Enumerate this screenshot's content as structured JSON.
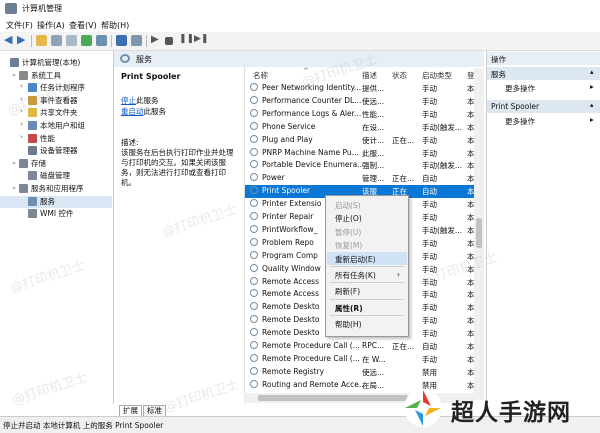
{
  "window": {
    "title": "计算机管理"
  },
  "menu": [
    "文件(F)",
    "操作(A)",
    "查看(V)",
    "帮助(H)"
  ],
  "header": {
    "label": "服务"
  },
  "tree": [
    {
      "label": "计算机管理(本地)",
      "level": 0,
      "arrow": "",
      "icon": "computer-icon",
      "color": "#6b7f94"
    },
    {
      "label": "系统工具",
      "level": 1,
      "arrow": "⌄",
      "icon": "tools-icon",
      "color": "#8a8a8a"
    },
    {
      "label": "任务计划程序",
      "level": 2,
      "arrow": "›",
      "icon": "clock-icon",
      "color": "#4b86c9"
    },
    {
      "label": "事件查看器",
      "level": 2,
      "arrow": "›",
      "icon": "event-icon",
      "color": "#c99b3b"
    },
    {
      "label": "共享文件夹",
      "level": 2,
      "arrow": "›",
      "icon": "folder-icon",
      "color": "#e2b742"
    },
    {
      "label": "本地用户和组",
      "level": 2,
      "arrow": "›",
      "icon": "users-icon",
      "color": "#6a8bb5"
    },
    {
      "label": "性能",
      "level": 2,
      "arrow": "›",
      "icon": "perf-icon",
      "color": "#c24a4a"
    },
    {
      "label": "设备管理器",
      "level": 2,
      "arrow": "",
      "icon": "device-icon",
      "color": "#6d7c8c"
    },
    {
      "label": "存储",
      "level": 1,
      "arrow": "⌄",
      "icon": "storage-icon",
      "color": "#7b8796"
    },
    {
      "label": "磁盘管理",
      "level": 2,
      "arrow": "",
      "icon": "disk-icon",
      "color": "#7b8796"
    },
    {
      "label": "服务和应用程序",
      "level": 1,
      "arrow": "⌄",
      "icon": "apps-icon",
      "color": "#7b8796"
    },
    {
      "label": "服务",
      "level": 2,
      "arrow": "",
      "icon": "services-icon",
      "color": "#6d8fb0",
      "selected": true
    },
    {
      "label": "WMI 控件",
      "level": 2,
      "arrow": "",
      "icon": "wmi-icon",
      "color": "#7b8796"
    }
  ],
  "desc": {
    "name": "Print Spooler",
    "stop": "停止",
    "stop_suffix": "此服务",
    "restart": "重启动",
    "restart_suffix": "此服务",
    "label": "描述:",
    "text": "该服务在后台执行打印作业并处理与打印机的交互。如果关闭该服务，则无法进行打印或查看打印机。"
  },
  "columns": [
    "名称",
    "描述",
    "状态",
    "启动类型",
    "登"
  ],
  "services": [
    {
      "name": "Peer Networking Identity...",
      "desc": "提供...",
      "status": "",
      "start": "手动",
      "logon": "本"
    },
    {
      "name": "Performance Counter DL...",
      "desc": "使远...",
      "status": "",
      "start": "手动",
      "logon": "本"
    },
    {
      "name": "Performance Logs & Aler...",
      "desc": "性能...",
      "status": "",
      "start": "手动",
      "logon": "本"
    },
    {
      "name": "Phone Service",
      "desc": "在设...",
      "status": "",
      "start": "手动(触发...",
      "logon": "本"
    },
    {
      "name": "Plug and Play",
      "desc": "使计...",
      "status": "正在...",
      "start": "手动",
      "logon": "本"
    },
    {
      "name": "PNRP Machine Name Pu...",
      "desc": "此服...",
      "status": "",
      "start": "手动",
      "logon": "本"
    },
    {
      "name": "Portable Device Enumera...",
      "desc": "强制...",
      "status": "",
      "start": "手动(触发...",
      "logon": "本"
    },
    {
      "name": "Power",
      "desc": "管理...",
      "status": "正在...",
      "start": "自动",
      "logon": "本"
    },
    {
      "name": "Print Spooler",
      "desc": "该服",
      "status": "正在",
      "start": "自动",
      "logon": "本",
      "selected": true
    },
    {
      "name": "Printer Extensio",
      "desc": "",
      "status": "",
      "start": "手动",
      "logon": "本"
    },
    {
      "name": "Printer Repair",
      "desc": "",
      "status": "",
      "start": "手动",
      "logon": "本"
    },
    {
      "name": "PrintWorkflow_",
      "desc": "",
      "status": "",
      "start": "手动(触发...",
      "logon": "本"
    },
    {
      "name": "Problem Repo",
      "desc": "",
      "status": "",
      "start": "手动",
      "logon": "本"
    },
    {
      "name": "Program Comp",
      "desc": "",
      "status": "",
      "start": "手动",
      "logon": "本"
    },
    {
      "name": "Quality Window",
      "desc": "",
      "status": "",
      "start": "手动",
      "logon": "本"
    },
    {
      "name": "Remote Access",
      "desc": "",
      "status": "",
      "start": "手动",
      "logon": "本"
    },
    {
      "name": "Remote Access",
      "desc": "",
      "status": "",
      "start": "手动",
      "logon": "本"
    },
    {
      "name": "Remote Deskto",
      "desc": "",
      "status": "",
      "start": "手动",
      "logon": "本"
    },
    {
      "name": "Remote Deskto",
      "desc": "",
      "status": "",
      "start": "手动",
      "logon": "本"
    },
    {
      "name": "Remote Deskto",
      "desc": "",
      "status": "",
      "start": "手动",
      "logon": "本"
    },
    {
      "name": "Remote Procedure Call (...",
      "desc": "RPC...",
      "status": "正在...",
      "start": "自动",
      "logon": "本"
    },
    {
      "name": "Remote Procedure Call (...",
      "desc": "在 W...",
      "status": "",
      "start": "手动",
      "logon": "本"
    },
    {
      "name": "Remote Registry",
      "desc": "使远...",
      "status": "",
      "start": "禁用",
      "logon": "本"
    },
    {
      "name": "Routing and Remote Acce...",
      "desc": "在局...",
      "status": "",
      "start": "禁用",
      "logon": "本"
    }
  ],
  "context_menu": [
    {
      "label": "启动(S)",
      "disabled": true
    },
    {
      "label": "停止(O)"
    },
    {
      "label": "暂停(U)",
      "disabled": true
    },
    {
      "label": "恢复(M)",
      "disabled": true
    },
    {
      "label": "重新启动(E)",
      "highlight": true
    },
    {
      "sep": true
    },
    {
      "label": "所有任务(K)",
      "submenu": true
    },
    {
      "sep": true
    },
    {
      "label": "刷新(F)"
    },
    {
      "sep": true
    },
    {
      "label": "属性(R)",
      "bold": true
    },
    {
      "sep": true
    },
    {
      "label": "帮助(H)"
    }
  ],
  "actions": {
    "title": "操作",
    "section1": "服务",
    "more1": "更多操作",
    "section2": "Print Spooler",
    "more2": "更多操作"
  },
  "tabs": [
    "扩展",
    "标准"
  ],
  "status_text": "停止并启动 本地计算机 上的服务 Print Spooler",
  "watermark": "@打印机卫士",
  "brand": "超人手游网",
  "colors": {
    "selection": "#0b78d6",
    "link": "#0b58c8",
    "header": "#e7eef6"
  }
}
